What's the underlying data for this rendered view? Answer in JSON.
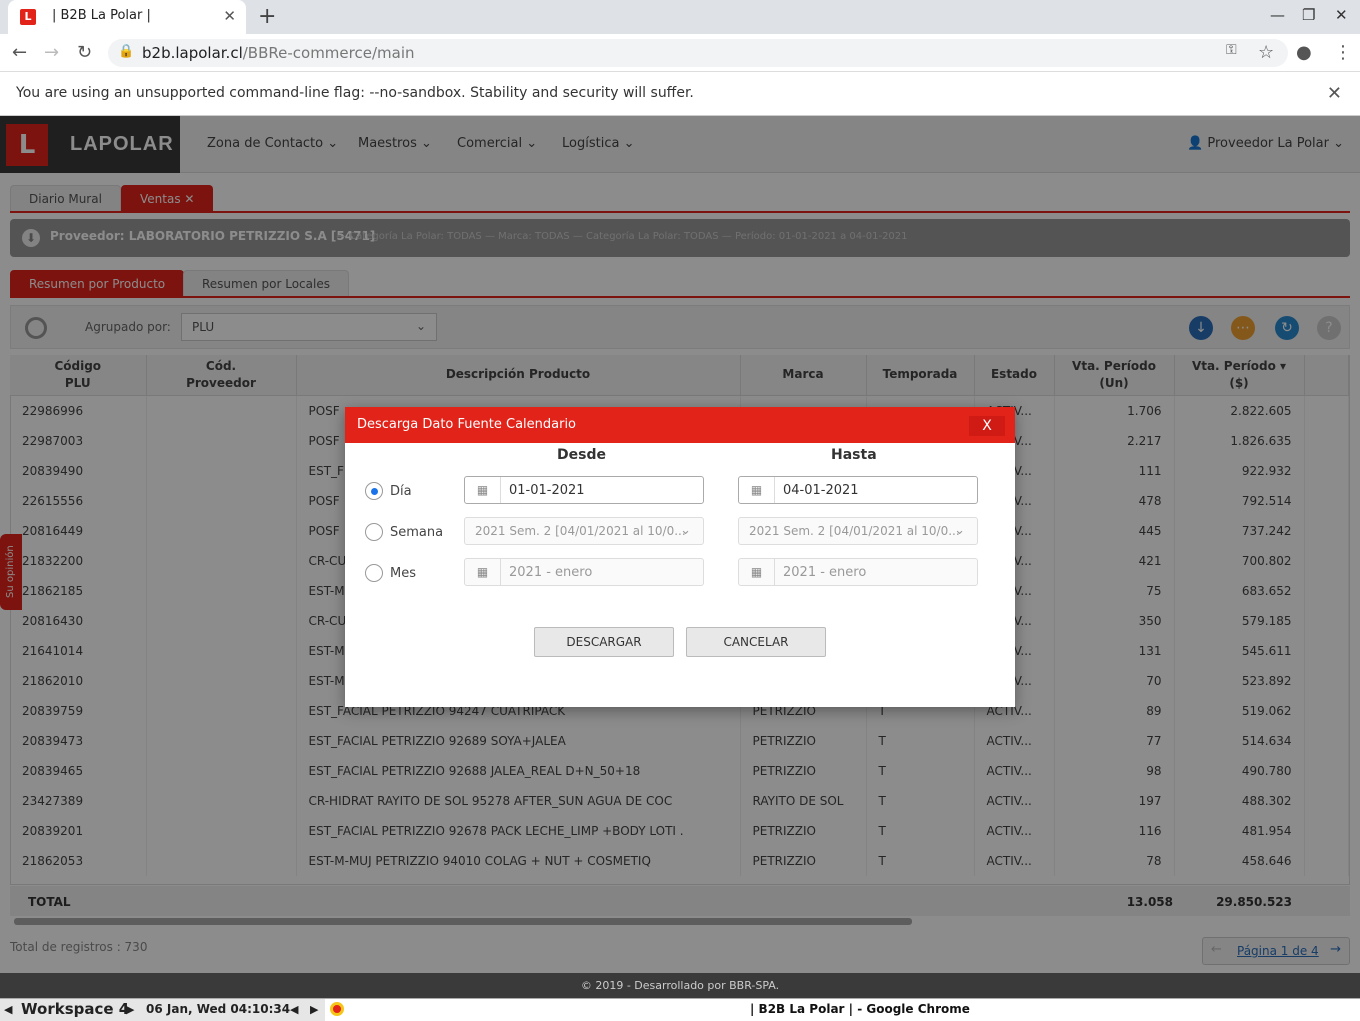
{
  "browser": {
    "tab_title": "| B2B La Polar |",
    "url_host": "b2b.lapolar.cl",
    "url_path": "/BBRe-commerce/main",
    "info_message": "You are using an unsupported command-line flag: --no-sandbox. Stability and security will suffer."
  },
  "app": {
    "logo_text": "LAPOLAR",
    "menu": [
      "Zona de Contacto",
      "Maestros",
      "Comercial",
      "Logística"
    ],
    "user": "Proveedor La Polar"
  },
  "tabs": [
    "Diario Mural",
    "Ventas"
  ],
  "filter": {
    "proveedor": "Proveedor: LABORATORIO PETRIZZIO S.A [5471]",
    "details": "— Categoría La Polar: TODAS — Marca: TODAS — Categoría La Polar: TODAS — Período: 01-01-2021 a 04-01-2021"
  },
  "subtabs": [
    "Resumen por Producto",
    "Resumen por Locales"
  ],
  "toolbar": {
    "group_label": "Agrupado por:",
    "group_value": "PLU"
  },
  "grid": {
    "headers": [
      [
        "Código",
        "PLU"
      ],
      [
        "Cód.",
        "Proveedor"
      ],
      [
        "Descripción Producto",
        ""
      ],
      [
        "Marca",
        ""
      ],
      [
        "Temporada",
        ""
      ],
      [
        "Estado",
        ""
      ],
      [
        "Vta. Período",
        "(Un)"
      ],
      [
        "Vta. Período",
        "($)"
      ]
    ],
    "rows": [
      [
        "22986996",
        "",
        "POSF",
        "",
        "",
        "ACTIV...",
        "1.706",
        "2.822.605"
      ],
      [
        "22987003",
        "",
        "POSF",
        "",
        "",
        "ACTIV...",
        "2.217",
        "1.826.635"
      ],
      [
        "20839490",
        "",
        "EST_F",
        "",
        "",
        "ACTIV...",
        "111",
        "922.932"
      ],
      [
        "22615556",
        "",
        "POSF",
        "",
        "",
        "ACTIV...",
        "478",
        "792.514"
      ],
      [
        "20816449",
        "",
        "POSF",
        "",
        "",
        "ACTIV...",
        "445",
        "737.242"
      ],
      [
        "21832200",
        "",
        "CR-CU",
        "",
        "",
        "ACTIV...",
        "421",
        "700.802"
      ],
      [
        "21862185",
        "",
        "EST-M",
        "",
        "",
        "ACTIV...",
        "75",
        "683.652"
      ],
      [
        "20816430",
        "",
        "CR-CU",
        "",
        "",
        "ACTIV...",
        "350",
        "579.185"
      ],
      [
        "21641014",
        "",
        "EST-M",
        "",
        "",
        "ACTIV...",
        "131",
        "545.611"
      ],
      [
        "21862010",
        "",
        "EST-M",
        "",
        "",
        "ACTIV...",
        "70",
        "523.892"
      ],
      [
        "20839759",
        "",
        "EST_FACIAL PETRIZZIO 94247 CUATRIPACK",
        "PETRIZZIO",
        "T",
        "ACTIV...",
        "89",
        "519.062"
      ],
      [
        "20839473",
        "",
        "EST_FACIAL PETRIZZIO 92689 SOYA+JALEA",
        "PETRIZZIO",
        "T",
        "ACTIV...",
        "77",
        "514.634"
      ],
      [
        "20839465",
        "",
        "EST_FACIAL PETRIZZIO 92688 JALEA_REAL D+N_50+18",
        "PETRIZZIO",
        "T",
        "ACTIV...",
        "98",
        "490.780"
      ],
      [
        "23427389",
        "",
        "CR-HIDRAT RAYITO DE SOL 95278 AFTER_SUN AGUA DE COC",
        "RAYITO DE SOL",
        "T",
        "ACTIV...",
        "197",
        "488.302"
      ],
      [
        "20839201",
        "",
        "EST_FACIAL PETRIZZIO 92678 PACK LECHE_LIMP +BODY LOTI .",
        "PETRIZZIO",
        "T",
        "ACTIV...",
        "116",
        "481.954"
      ],
      [
        "21862053",
        "",
        "EST-M-MUJ PETRIZZIO 94010 COLAG + NUT + COSMETIQ",
        "PETRIZZIO",
        "T",
        "ACTIV...",
        "78",
        "458.646"
      ]
    ],
    "total_label": "TOTAL",
    "total_un": "13.058",
    "total_pesos": "29.850.523"
  },
  "footer": {
    "count": "Total de registros : 730",
    "page": "Página 1 de 4",
    "copyright": "© 2019 - Desarrollado por BBR-SPA."
  },
  "side_tab": "Su opinión",
  "modal": {
    "title": "Descarga Dato Fuente Calendario",
    "close": "X",
    "col_from": "Desde",
    "col_to": "Hasta",
    "opt_day": "Día",
    "opt_week": "Semana",
    "opt_month": "Mes",
    "day_from": "01-01-2021",
    "day_to": "04-01-2021",
    "week_from": "2021 Sem. 2 [04/01/2021 al 10/0...",
    "week_to": "2021 Sem. 2 [04/01/2021 al 10/0...",
    "month_from": "2021 - enero",
    "month_to": "2021 - enero",
    "download": "DESCARGAR",
    "cancel": "CANCELAR"
  },
  "taskbar": {
    "workspace": "Workspace 4",
    "datetime": "06 Jan, Wed 04:10:34",
    "window": "| B2B La Polar | - Google Chrome"
  },
  "colors": {
    "brand_red": "#e2231a",
    "radio_blue": "#1a73e8"
  }
}
